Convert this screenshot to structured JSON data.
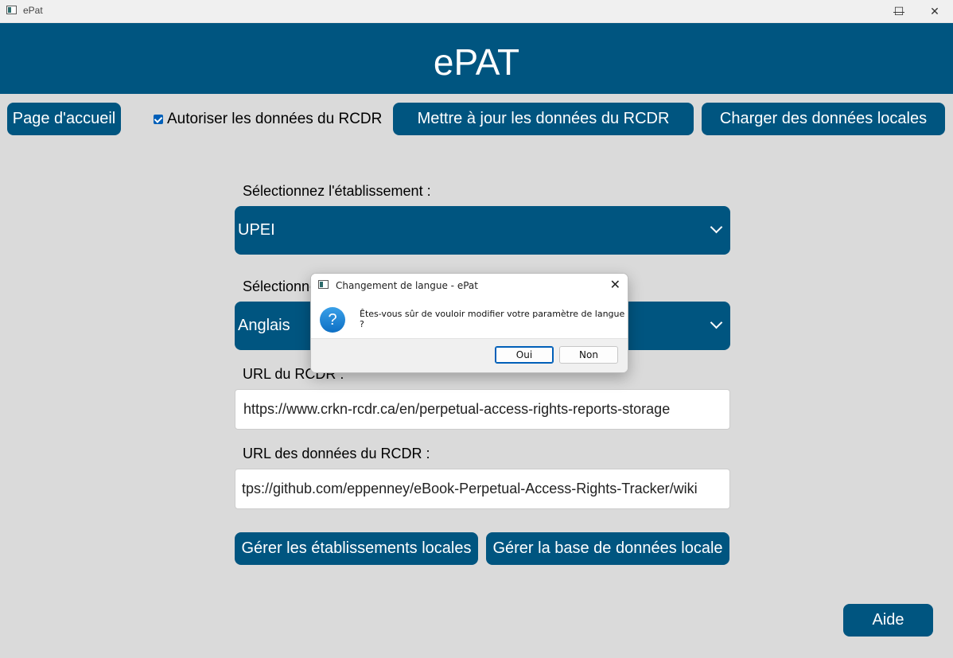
{
  "window": {
    "title": "ePat",
    "minimize_icon": "—",
    "maximize_icon": "☐",
    "close_icon": "✕"
  },
  "header": {
    "title": "ePAT"
  },
  "toolbar": {
    "home_label": "Page d'accueil",
    "allow_label": "Autoriser les données du RCDR",
    "allow_checked": true,
    "update_label": "Mettre à jour les données du RCDR",
    "load_label": "Charger des données locales"
  },
  "form": {
    "institution_label": "Sélectionnez l'établissement :",
    "institution_value": "UPEI",
    "language_label": "Sélectionnez la langue :",
    "language_value": "Anglais",
    "crkn_url_label": "URL du RCDR :",
    "crkn_url_value": "https://www.crkn-rcdr.ca/en/perpetual-access-rights-reports-storage",
    "crkn_data_url_label": "URL des données du RCDR :",
    "crkn_data_url_value": "tps://github.com/eppenney/eBook-Perpetual-Access-Rights-Tracker/wiki"
  },
  "actions": {
    "manage_institutions_label": "Gérer les établissements locales",
    "manage_db_label": "Gérer la base de données locale",
    "help_label": "Aide"
  },
  "dialog": {
    "title": "Changement de langue - ePat",
    "close_icon": "✕",
    "question_icon": "?",
    "message": "Êtes-vous sûr de vouloir modifier votre paramètre de langue ?",
    "yes_label": "Oui",
    "no_label": "Non"
  },
  "colors": {
    "accent": "#005580",
    "background": "#dadada"
  }
}
